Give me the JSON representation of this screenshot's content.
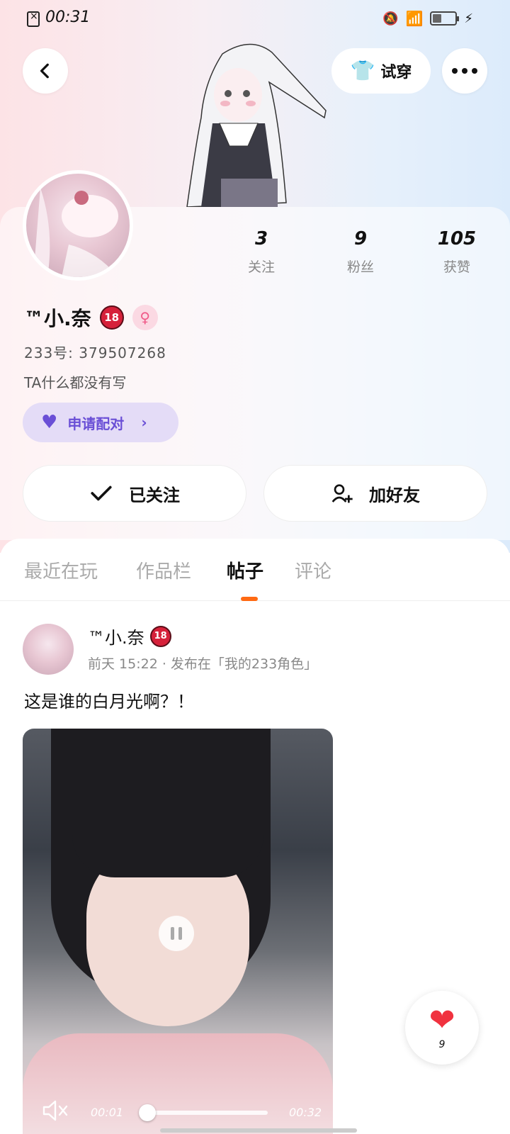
{
  "status_bar": {
    "time": "00:31"
  },
  "header": {
    "tryon_label": "试穿"
  },
  "stats": [
    {
      "value": "3",
      "label": "关注"
    },
    {
      "value": "9",
      "label": "粉丝"
    },
    {
      "value": "105",
      "label": "获赞"
    }
  ],
  "profile": {
    "name": "™小.奈",
    "badge": "18",
    "gender_symbol": "♀",
    "account_id": "233号: 379507268",
    "bio": "TA什么都没有写",
    "pair_label": "申请配对",
    "followed_label": "已关注",
    "add_friend_label": "加好友"
  },
  "tabs": [
    {
      "label": "最近在玩"
    },
    {
      "label": "作品栏"
    },
    {
      "label": "帖子"
    },
    {
      "label": "评论"
    }
  ],
  "post": {
    "author": "™小.奈",
    "meta": "前天 15:22 · 发布在「我的233角色」",
    "text": "这是谁的白月光啊？！",
    "video": {
      "current_time": "00:01",
      "total_time": "00:32",
      "progress": 0.03
    }
  },
  "like": {
    "count": "9"
  },
  "icons": {
    "back": "chevron-left-icon",
    "tryon": "shirt-icon",
    "more": "more-icon",
    "pair": "heart-icon",
    "followed": "check-icon",
    "add_friend": "person-plus-icon",
    "mute": "mute-icon",
    "pause": "pause-icon",
    "like": "heart-icon"
  },
  "colors": {
    "accent_orange": "#ff6a13",
    "pair_purple": "#6a4fd6",
    "like_red": "#f0323f",
    "badge_red": "#d6213a"
  }
}
